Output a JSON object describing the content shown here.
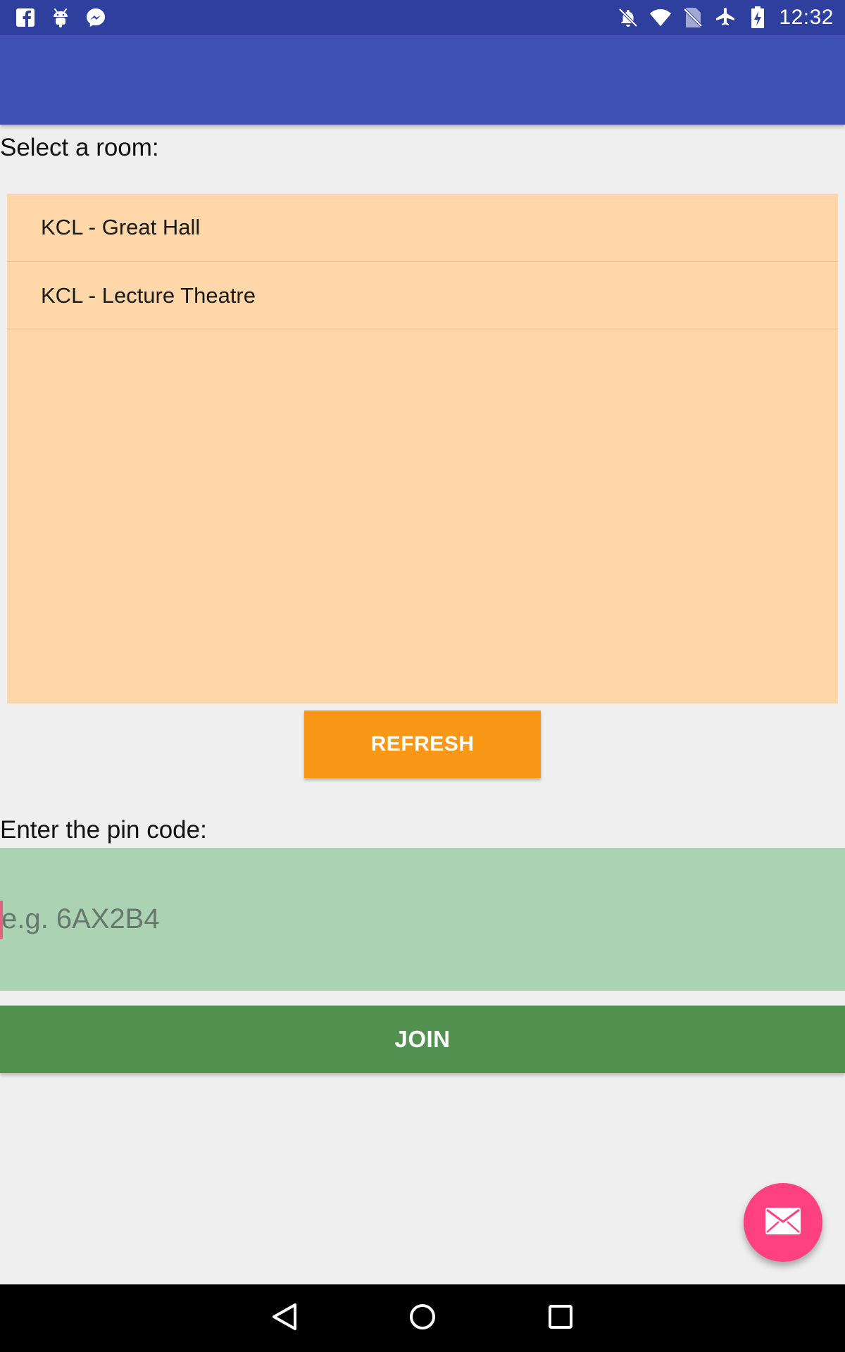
{
  "status_bar": {
    "time": "12:32",
    "left_icons": [
      "facebook-icon",
      "android-debug-icon",
      "messenger-icon"
    ],
    "right_icons": [
      "notifications-off-icon",
      "wifi-icon",
      "no-sim-icon",
      "airplane-mode-icon",
      "battery-charging-icon"
    ]
  },
  "app_bar": {
    "title": ""
  },
  "rooms": {
    "label": "Select a room:",
    "items": [
      {
        "label": "KCL - Great Hall"
      },
      {
        "label": "KCL - Lecture Theatre"
      }
    ],
    "refresh_label": "REFRESH"
  },
  "pin": {
    "label": "Enter the pin code:",
    "placeholder": "e.g. 6AX2B4",
    "value": ""
  },
  "join_label": "JOIN",
  "fab_icon": "mail-icon",
  "nav_bar": {
    "icons": [
      "back-icon",
      "home-icon",
      "recents-icon"
    ]
  },
  "colors": {
    "status_bar": "#2f3f9e",
    "app_bar": "#3f51b5",
    "room_list_bg": "#ffd7a8",
    "refresh_button": "#f99716",
    "pin_field_bg": "#abd3b3",
    "join_button": "#52914f",
    "fab": "#ff4081"
  }
}
